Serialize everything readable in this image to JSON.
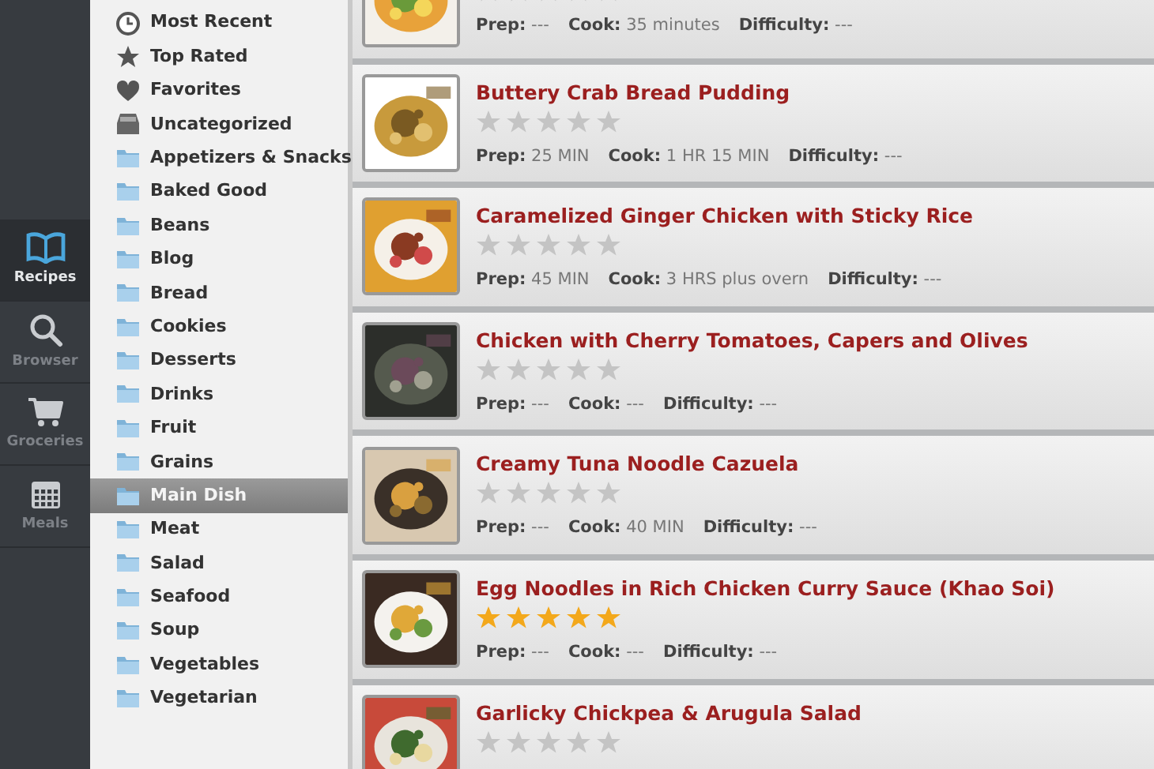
{
  "nav": [
    {
      "label": "Recipes",
      "kind": "book",
      "selected": true
    },
    {
      "label": "Browser",
      "kind": "search",
      "selected": false
    },
    {
      "label": "Groceries",
      "kind": "cart",
      "selected": false
    },
    {
      "label": "Meals",
      "kind": "calendar",
      "selected": false
    }
  ],
  "categories": [
    {
      "label": "Most Recent",
      "kind": "clock",
      "selected": false
    },
    {
      "label": "Top Rated",
      "kind": "star",
      "selected": false
    },
    {
      "label": "Favorites",
      "kind": "heart",
      "selected": false
    },
    {
      "label": "Uncategorized",
      "kind": "tray",
      "selected": false
    },
    {
      "label": "Appetizers & Snacks",
      "kind": "folder",
      "selected": false
    },
    {
      "label": "Baked Good",
      "kind": "folder",
      "selected": false
    },
    {
      "label": "Beans",
      "kind": "folder",
      "selected": false
    },
    {
      "label": "Blog",
      "kind": "folder",
      "selected": false
    },
    {
      "label": "Bread",
      "kind": "folder",
      "selected": false
    },
    {
      "label": "Cookies",
      "kind": "folder",
      "selected": false
    },
    {
      "label": "Desserts",
      "kind": "folder",
      "selected": false
    },
    {
      "label": "Drinks",
      "kind": "folder",
      "selected": false
    },
    {
      "label": "Fruit",
      "kind": "folder",
      "selected": false
    },
    {
      "label": "Grains",
      "kind": "folder",
      "selected": false
    },
    {
      "label": "Main Dish",
      "kind": "folder",
      "selected": true
    },
    {
      "label": "Meat",
      "kind": "folder",
      "selected": false
    },
    {
      "label": "Salad",
      "kind": "folder",
      "selected": false
    },
    {
      "label": "Seafood",
      "kind": "folder",
      "selected": false
    },
    {
      "label": "Soup",
      "kind": "folder",
      "selected": false
    },
    {
      "label": "Vegetables",
      "kind": "folder",
      "selected": false
    },
    {
      "label": "Vegetarian",
      "kind": "folder",
      "selected": false
    }
  ],
  "recipes": [
    {
      "stars": 0,
      "prep_label": "Prep:",
      "prep": "---",
      "cook_label": "Cook:",
      "cook": "35 minutes",
      "difficulty_label": "Difficulty:",
      "difficulty": "---"
    },
    {
      "title": "Buttery Crab Bread Pudding",
      "stars": 0,
      "prep_label": "Prep:",
      "prep": "25 MIN",
      "cook_label": "Cook:",
      "cook": "1 HR 15 MIN",
      "difficulty_label": "Difficulty:",
      "difficulty": "---"
    },
    {
      "title": "Caramelized Ginger Chicken with Sticky Rice",
      "stars": 0,
      "prep_label": "Prep:",
      "prep": "45 MIN",
      "cook_label": "Cook:",
      "cook": "3 HRS plus overn",
      "difficulty_label": "Difficulty:",
      "difficulty": "---"
    },
    {
      "title": "Chicken with Cherry Tomatoes, Capers and Olives",
      "stars": 0,
      "prep_label": "Prep:",
      "prep": "---",
      "cook_label": "Cook:",
      "cook": "---",
      "difficulty_label": "Difficulty:",
      "difficulty": "---"
    },
    {
      "title": "Creamy Tuna Noodle Cazuela",
      "stars": 0,
      "prep_label": "Prep:",
      "prep": "---",
      "cook_label": "Cook:",
      "cook": "40 MIN",
      "difficulty_label": "Difficulty:",
      "difficulty": "---"
    },
    {
      "title": "Egg Noodles in Rich Chicken Curry Sauce (Khao Soi)",
      "stars": 5,
      "prep_label": "Prep:",
      "prep": "---",
      "cook_label": "Cook:",
      "cook": "---",
      "difficulty_label": "Difficulty:",
      "difficulty": "---"
    },
    {
      "title": "Garlicky Chickpea & Arugula Salad",
      "stars": 0
    }
  ]
}
